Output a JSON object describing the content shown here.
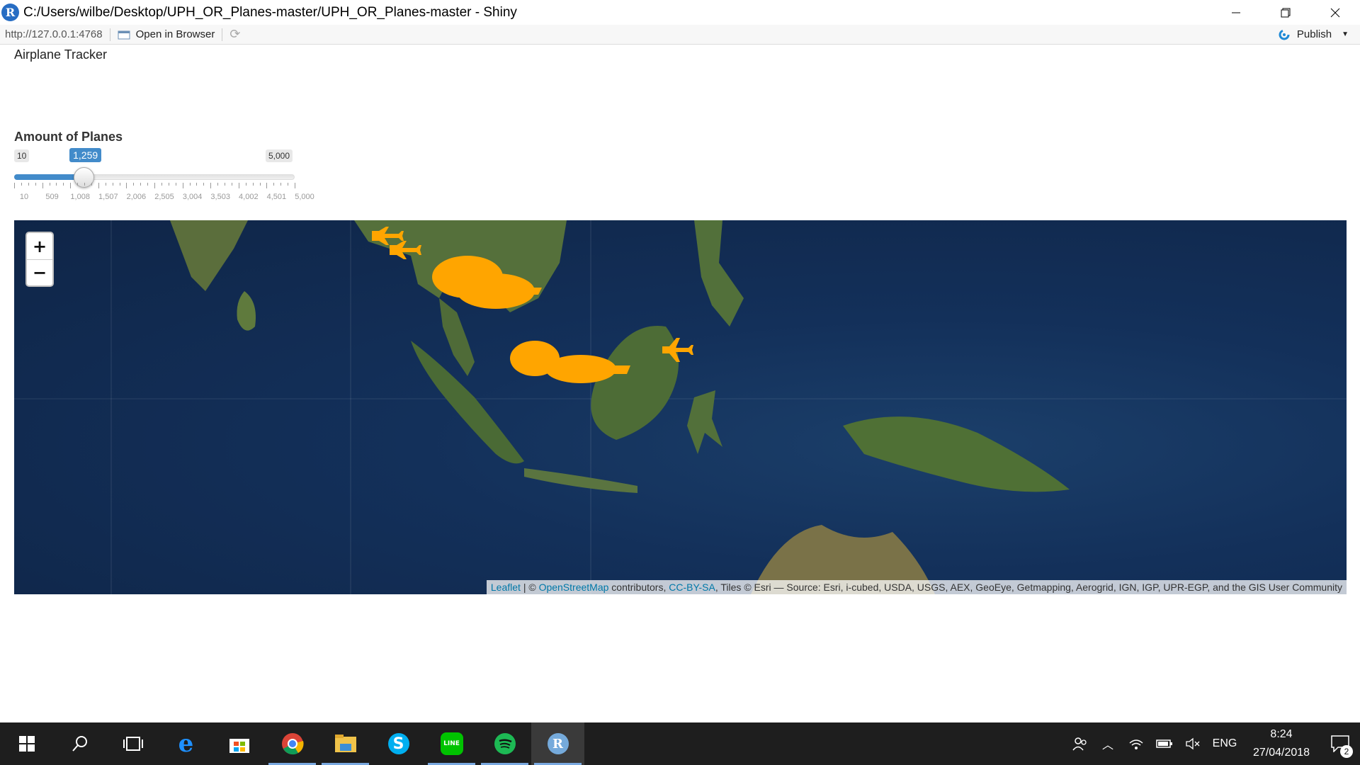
{
  "window": {
    "title": "C:/Users/wilbe/Desktop/UPH_OR_Planes-master/UPH_OR_Planes-master - Shiny",
    "r_logo": "R"
  },
  "toolbar": {
    "url": "http://127.0.0.1:4768",
    "open_in_browser": "Open in Browser",
    "publish": "Publish"
  },
  "app": {
    "title": "Airplane Tracker",
    "slider": {
      "label": "Amount of Planes",
      "min_label": "10",
      "max_label": "5,000",
      "current_label": "1,259",
      "value": 1259,
      "min": 10,
      "max": 5000,
      "tick_labels": [
        "10",
        "509",
        "1,008",
        "1,507",
        "2,006",
        "2,505",
        "3,004",
        "3,503",
        "4,002",
        "4,501",
        "5,000"
      ]
    }
  },
  "map": {
    "zoom_in": "+",
    "zoom_out": "−",
    "attribution": {
      "leaflet": "Leaflet",
      "sep1": " | © ",
      "osm": "OpenStreetMap",
      "contributors": " contributors, ",
      "license": "CC-BY-SA",
      "tiles": ", Tiles © Esri — Source: Esri, i-cubed, USDA, USGS, AEX, GeoEye, Getmapping, Aerogrid, IGN, IGP, UPR-EGP, and the GIS User Community"
    },
    "marker_color": "#ffa500",
    "land_color": "#4d6a3a",
    "ocean_color": "#13305a"
  },
  "taskbar": {
    "apps": [
      "start-icon",
      "search-icon",
      "task-view-icon",
      "edge-icon",
      "store-icon",
      "chrome-icon",
      "file-explorer-icon",
      "skype-icon",
      "line-icon",
      "spotify-icon",
      "rstudio-icon"
    ],
    "language": "ENG",
    "time": "8:24",
    "date": "27/04/2018",
    "notifications": "2"
  }
}
